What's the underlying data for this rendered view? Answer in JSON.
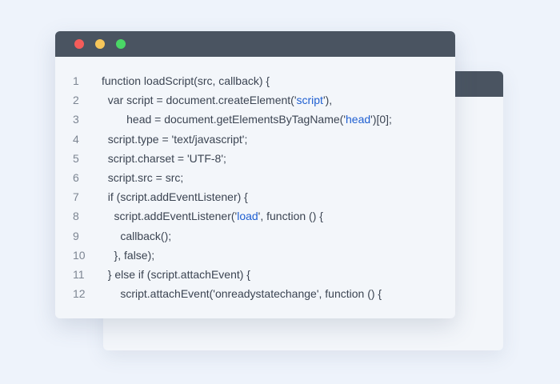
{
  "code": {
    "line_numbers": [
      "1",
      "2",
      "3",
      "4",
      "5",
      "6",
      "7",
      "8",
      "9",
      "10",
      "11",
      "12"
    ],
    "lines": [
      [
        {
          "t": "function loadScript(src, callback) {"
        }
      ],
      [
        {
          "t": "  var script = document.createElement('"
        },
        {
          "t": "script",
          "s": 1
        },
        {
          "t": "'),"
        }
      ],
      [
        {
          "t": "        head = document.getElementsByTagName('"
        },
        {
          "t": "head",
          "s": 1
        },
        {
          "t": "')[0];"
        }
      ],
      [
        {
          "t": "  script.type = 'text/javascript';"
        }
      ],
      [
        {
          "t": "  script.charset = 'UTF-8';"
        }
      ],
      [
        {
          "t": "  script.src = src;"
        }
      ],
      [
        {
          "t": "  if (script.addEventListener) {"
        }
      ],
      [
        {
          "t": "    script.addEventListener('"
        },
        {
          "t": "load",
          "s": 1
        },
        {
          "t": "', function () {"
        }
      ],
      [
        {
          "t": "      callback();"
        }
      ],
      [
        {
          "t": "    }, false);"
        }
      ],
      [
        {
          "t": "  } else if (script.attachEvent) {"
        }
      ],
      [
        {
          "t": "      script.attachEvent('onreadystatechange', function () {"
        }
      ]
    ]
  },
  "colors": {
    "titlebar": "#4a5461",
    "close": "#f55c5a",
    "minimize": "#f7c65a",
    "maximize": "#4ad766",
    "string_highlight": "#1f5fd1"
  }
}
